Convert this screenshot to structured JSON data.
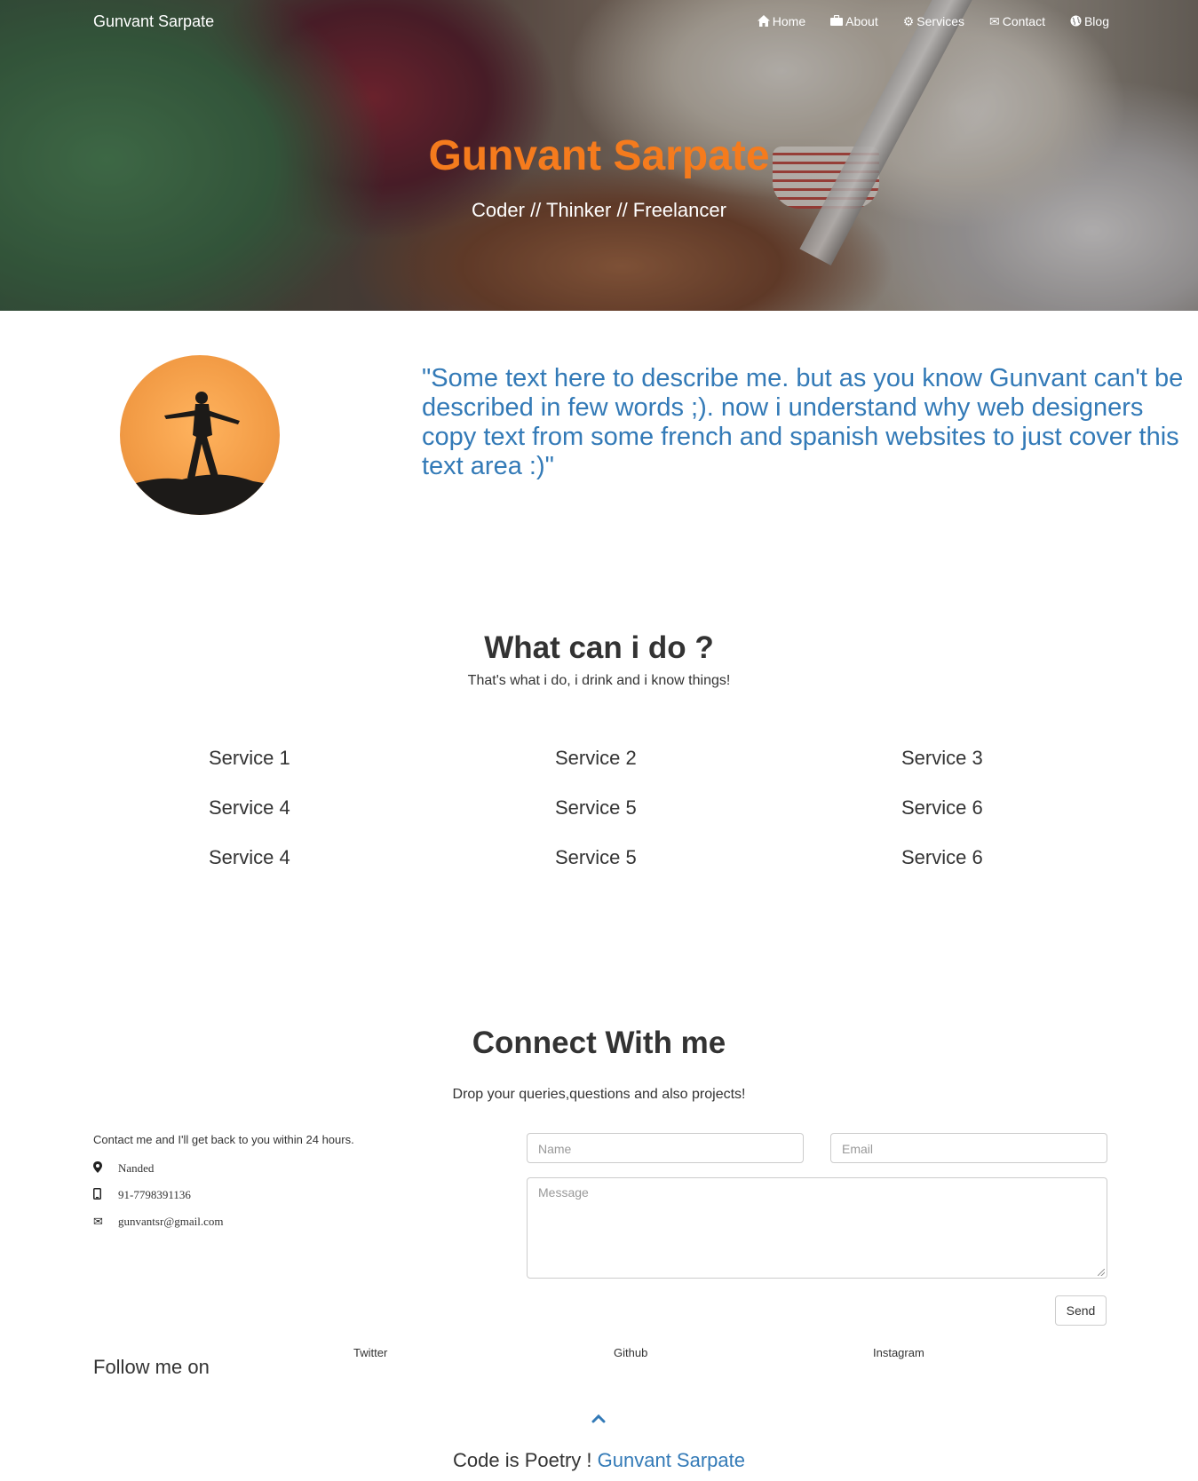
{
  "header": {
    "brand": "Gunvant Sarpate",
    "nav": [
      {
        "label": "Home",
        "icon": "home-icon"
      },
      {
        "label": "About",
        "icon": "briefcase-icon"
      },
      {
        "label": "Services",
        "icon": "gear-icon"
      },
      {
        "label": "Contact",
        "icon": "envelope-icon"
      },
      {
        "label": "Blog",
        "icon": "globe-icon"
      }
    ]
  },
  "hero": {
    "title": "Gunvant Sarpate",
    "subtitle": "Coder // Thinker // Freelancer"
  },
  "about": {
    "quote": "\"Some text here to describe me. but as you know Gunvant can't be described in few words ;). now i understand why web designers copy text from some french and spanish websites to just cover this text area :)\""
  },
  "services": {
    "title": "What can i do ?",
    "subtitle": "That's what i do, i drink and i know things!",
    "items": [
      "Service 1",
      "Service 2",
      "Service 3",
      "Service 4",
      "Service 5",
      "Service 6",
      "Service 4",
      "Service 5",
      "Service 6"
    ]
  },
  "contact": {
    "title": "Connect With me",
    "subtitle": "Drop your queries,questions and also projects!",
    "note": "Contact me and I'll get back to you within 24 hours.",
    "location": "Nanded",
    "phone": "91-7798391136",
    "email": "gunvantsr@gmail.com",
    "form": {
      "name_placeholder": "Name",
      "email_placeholder": "Email",
      "message_placeholder": "Message",
      "send_label": "Send"
    }
  },
  "follow": {
    "label": "Follow me on",
    "links": [
      "Twitter",
      "Github",
      "Instagram"
    ]
  },
  "footer": {
    "text": "Code is Poetry ! ",
    "name": "Gunvant Sarpate"
  },
  "colors": {
    "accent_orange": "#f57b1d",
    "link_blue": "#337ab7",
    "text": "#333333"
  }
}
